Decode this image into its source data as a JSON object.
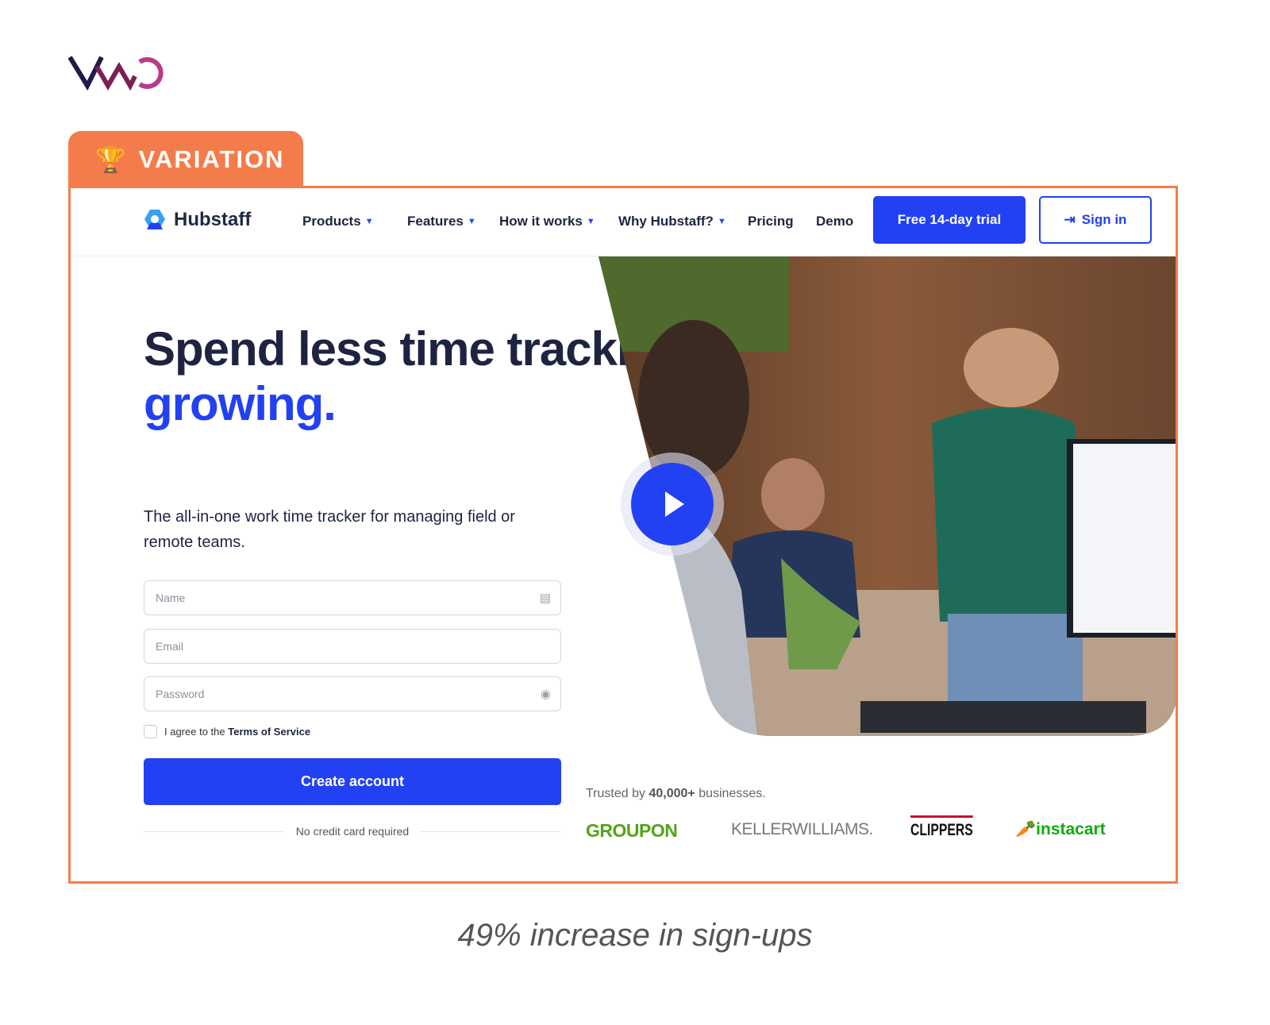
{
  "vwo_logo": "VWO",
  "tab_label": "VARIATION",
  "nav": {
    "brand": "Hubstaff",
    "items": [
      "Products",
      "Features",
      "How it works",
      "Why Hubstaff?",
      "Pricing",
      "Demo"
    ],
    "trial_button": "Free 14-day trial",
    "sign_in_button": "Sign in"
  },
  "hero": {
    "headline_part1": "Spend less time tracking and more time",
    "headline_highlight": "growing.",
    "subtitle": "The all-in-one work time tracker for managing field or remote teams."
  },
  "form": {
    "name_placeholder": "Name",
    "email_placeholder": "Email",
    "password_placeholder": "Password",
    "agree_prefix": "I agree to the",
    "terms_link": "Terms of Service",
    "submit": "Create account",
    "no_card": "No credit card required"
  },
  "trusted": {
    "prefix": "Trusted by",
    "count": "40,000+",
    "suffix": "businesses."
  },
  "logos": [
    "GROUPON",
    "KELLERWILLIAMS.",
    "CLIPPERS",
    "instacart"
  ],
  "caption": "49% increase in sign-ups",
  "colors": {
    "accent": "#2241f2",
    "variation": "#f47c4a",
    "groupon": "#53a318",
    "instacart": "#0aad0a"
  }
}
